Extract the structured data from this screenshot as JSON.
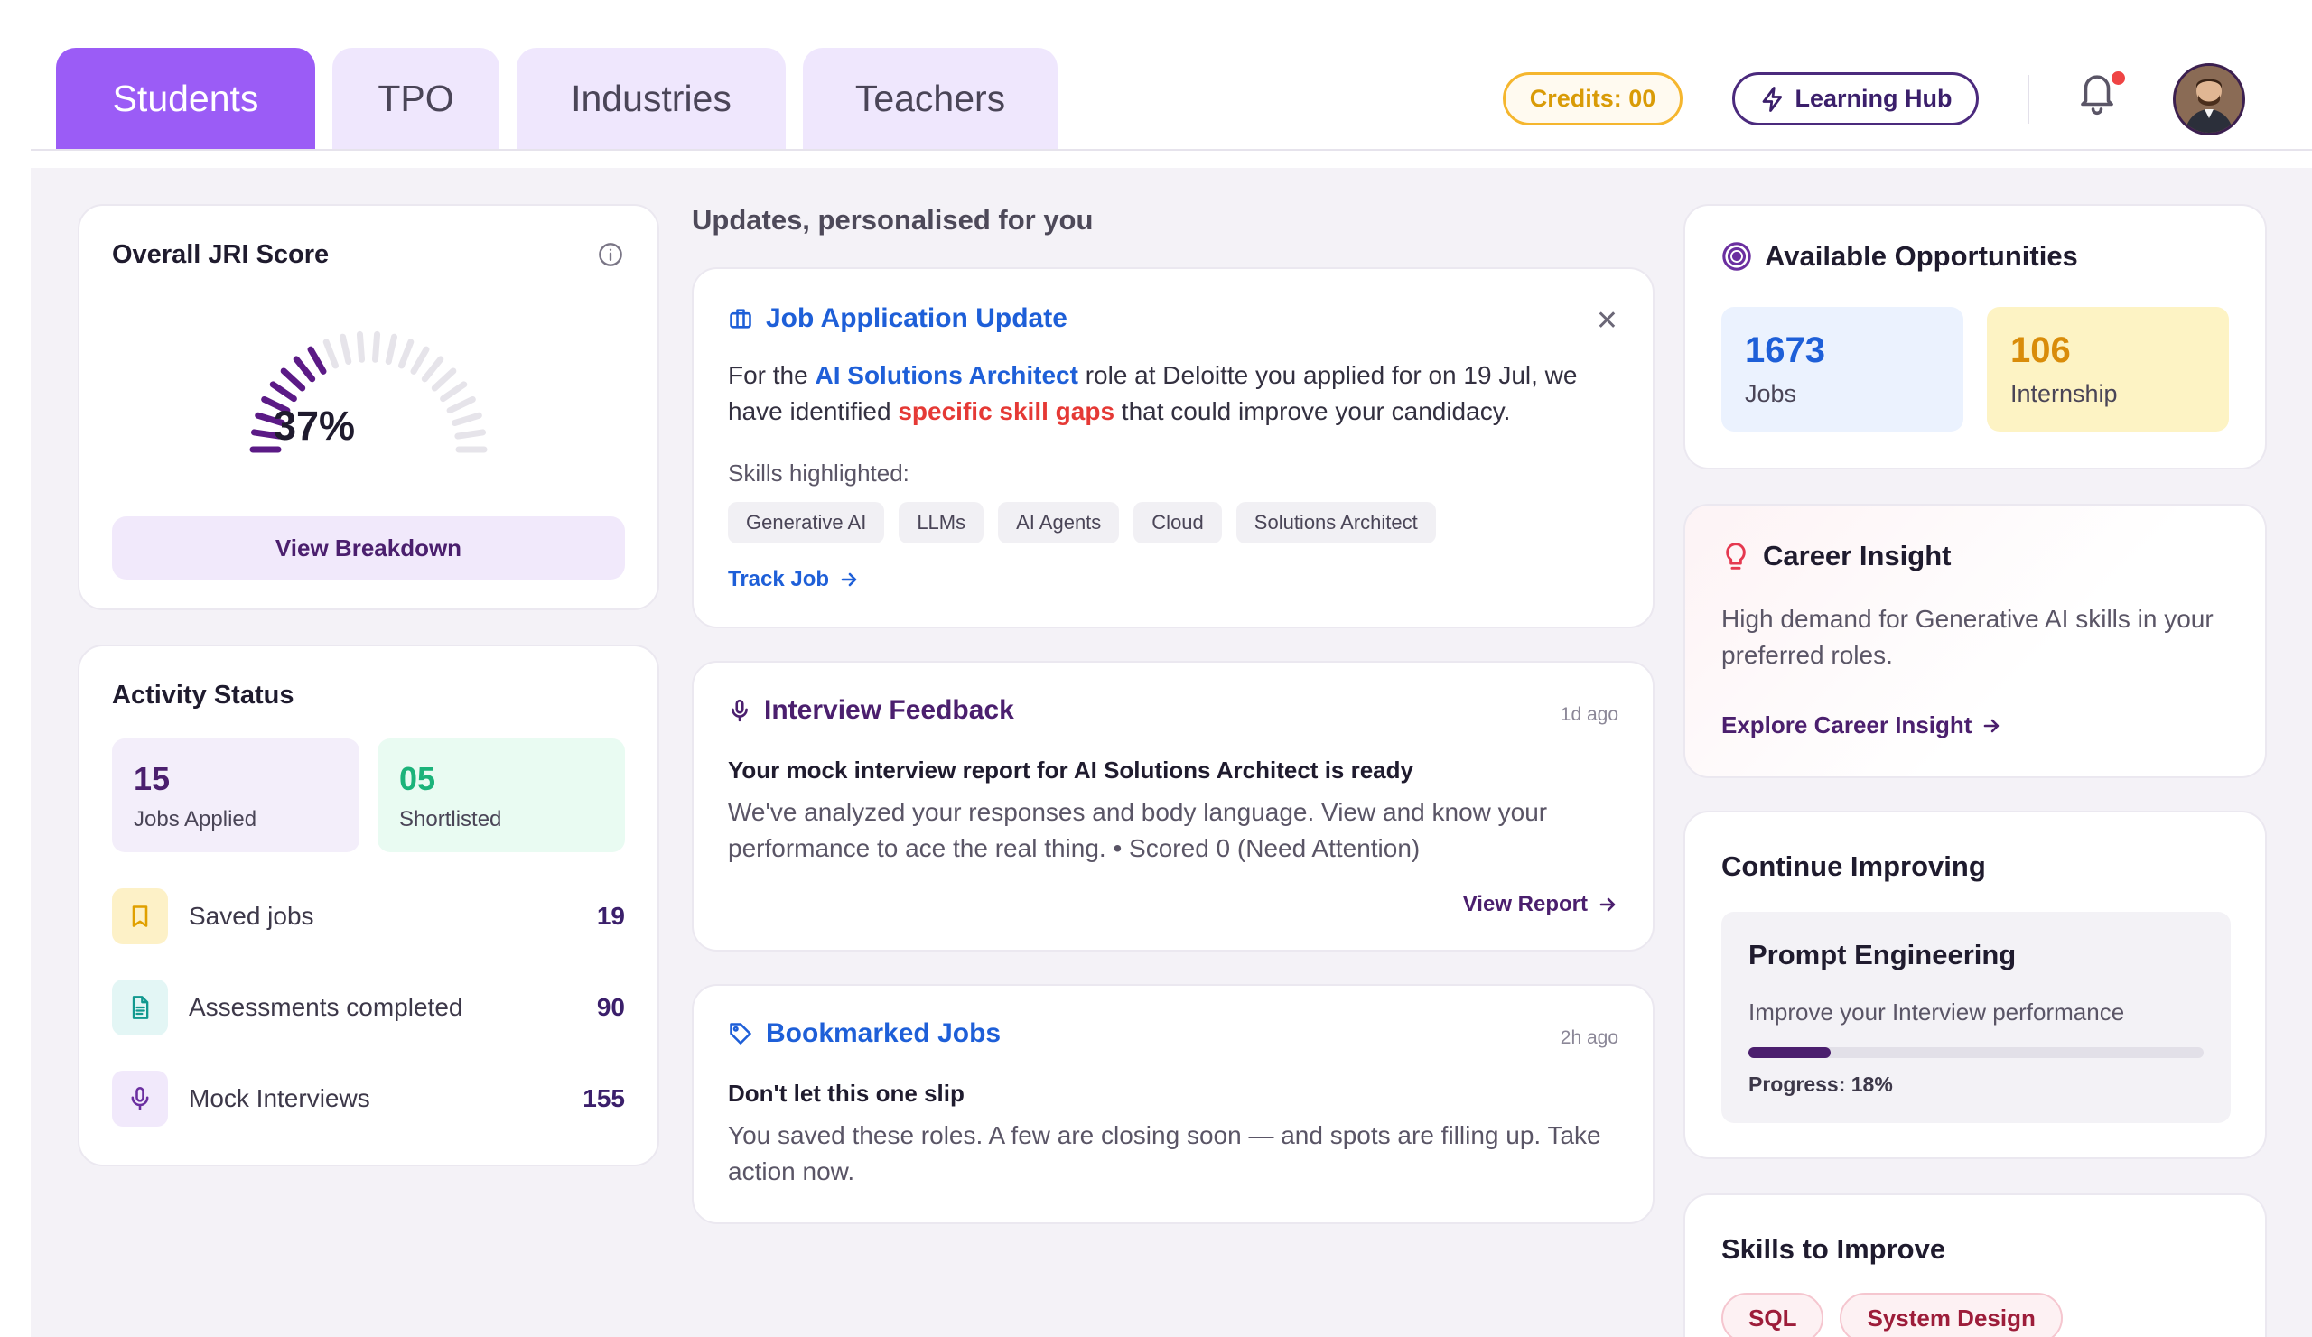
{
  "tabs": [
    {
      "label": "Students",
      "active": true
    },
    {
      "label": "TPO",
      "active": false
    },
    {
      "label": "Industries",
      "active": false
    },
    {
      "label": "Teachers",
      "active": false
    }
  ],
  "header": {
    "credits_label": "Credits: 00",
    "learning_hub_label": "Learning Hub",
    "notification_icon": "bell-icon",
    "has_notification": true
  },
  "jri": {
    "title": "Overall JRI Score",
    "score_text": "37%",
    "score_fraction": 0.37,
    "button_label": "View Breakdown"
  },
  "activity": {
    "title": "Activity Status",
    "jobs_applied": {
      "value": "15",
      "label": "Jobs Applied"
    },
    "shortlisted": {
      "value": "05",
      "label": "Shortlisted"
    },
    "rows": [
      {
        "label": "Saved jobs",
        "count": "19",
        "icon": "bookmark-icon"
      },
      {
        "label": "Assessments completed",
        "count": "90",
        "icon": "document-icon"
      },
      {
        "label": "Mock Interviews",
        "count": "155",
        "icon": "microphone-icon"
      }
    ]
  },
  "updates": {
    "section_title": "Updates, personalised for you",
    "job_update": {
      "title": "Job Application Update",
      "body_1": "For the ",
      "role": "AI Solutions Architect",
      "body_2": " role at Deloitte you applied for on 19 Jul, we have identified ",
      "gap": "specific skill gaps",
      "body_3": " that could improve your candidacy.",
      "skills_label": "Skills highlighted:",
      "skills": [
        "Generative AI",
        "LLMs",
        "AI Agents",
        "Cloud",
        "Solutions Architect"
      ],
      "link_label": "Track Job"
    },
    "interview": {
      "title": "Interview Feedback",
      "time": "1d ago",
      "headline": "Your mock interview report for AI Solutions Architect is ready",
      "text": "We've analyzed your responses and body language. View and know your performance to ace the real thing. • Scored 0 (Need Attention)",
      "link_label": "View Report"
    },
    "bookmarked": {
      "title": "Bookmarked Jobs",
      "time": "2h ago",
      "headline": "Don't let this one slip",
      "text": "You saved these roles. A few are closing soon — and spots are filling up. Take action now."
    }
  },
  "opportunities": {
    "title": "Available Opportunities",
    "jobs": {
      "value": "1673",
      "label": "Jobs"
    },
    "internship": {
      "value": "106",
      "label": "Internship"
    }
  },
  "career_insight": {
    "title": "Career Insight",
    "text": "High demand for Generative AI skills in your preferred roles.",
    "link_label": "Explore Career Insight"
  },
  "continue_improving": {
    "title": "Continue Improving",
    "course_title": "Prompt Engineering",
    "course_desc": "Improve your Interview performance",
    "progress_fraction": 0.18,
    "progress_label": "Progress: 18%"
  },
  "skills_to_improve": {
    "title": "Skills to Improve",
    "skills": [
      "SQL",
      "System Design"
    ]
  },
  "colors": {
    "accent": "#9b5cf6",
    "brand_dark": "#4b1f6e",
    "link_blue": "#1e5fd8",
    "alert_red": "#e53935",
    "credits_gold": "#f5b62e"
  }
}
